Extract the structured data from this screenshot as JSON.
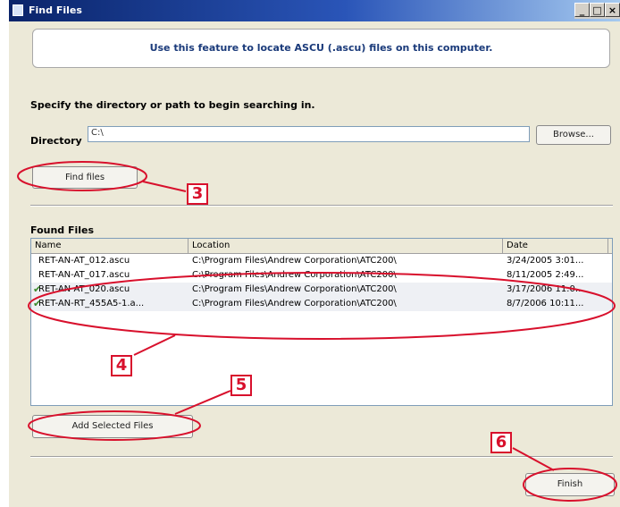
{
  "window": {
    "title": "Find Files",
    "controls": [
      "_",
      "□",
      "×"
    ]
  },
  "banner": "Use this feature to locate ASCU (.ascu) files on this computer.",
  "instruction": "Specify the directory or path to begin searching in.",
  "directory": {
    "label": "Directory",
    "value": "C:\\"
  },
  "browse_label": "Browse...",
  "find_label": "Find  files",
  "found_files": {
    "label": "Found Files",
    "columns": [
      "Name",
      "Location",
      "Date"
    ],
    "rows": [
      {
        "name": "RET-AN-AT_012.ascu",
        "location": "C:\\Program Files\\Andrew Corporation\\ATC200\\",
        "date": "3/24/2005 3:01...",
        "checked": false
      },
      {
        "name": "RET-AN-AT_017.ascu",
        "location": "C:\\Program Files\\Andrew Corporation\\ATC200\\",
        "date": "8/11/2005 2:49...",
        "checked": false
      },
      {
        "name": "RET-AN-AT_020.ascu",
        "location": "C:\\Program Files\\Andrew Corporation\\ATC200\\",
        "date": "3/17/2006 11:0...",
        "checked": true
      },
      {
        "name": "RET-AN-RT_455A5-1.a...",
        "location": "C:\\Program Files\\Andrew Corporation\\ATC200\\",
        "date": "8/7/2006 10:11...",
        "checked": true
      }
    ]
  },
  "add_label": "Add Selected Files",
  "finish_label": "Finish",
  "callouts": [
    "3",
    "4",
    "5",
    "6"
  ],
  "colors": {
    "callout": "#d8102c",
    "titlebar": "#0a246a",
    "check": "#3a8a2a"
  },
  "icons": {
    "app": "window-icon",
    "check": "checkmark-icon"
  }
}
